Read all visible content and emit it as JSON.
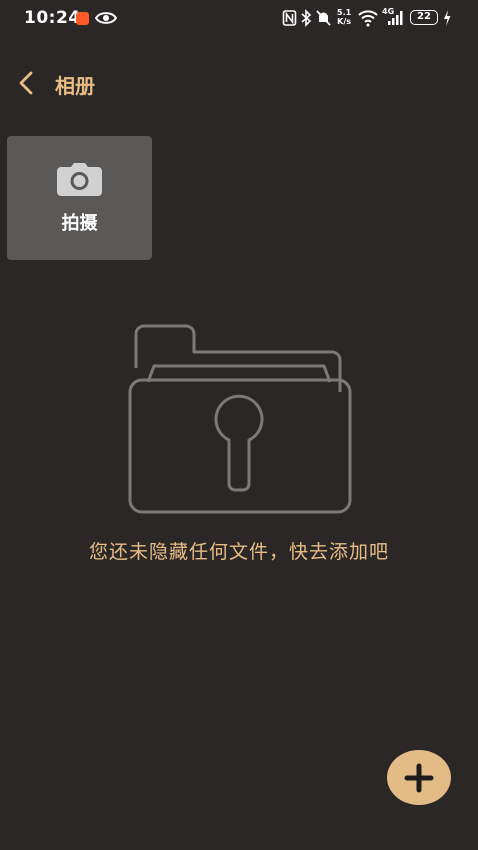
{
  "status_bar": {
    "time": "10:24",
    "network_speed": "5.1",
    "network_unit": "K/s",
    "network_type": "4G",
    "battery": "22"
  },
  "header": {
    "back_icon": "chevron-left-icon",
    "title": "相册"
  },
  "capture_tile": {
    "icon": "camera-icon",
    "label": "拍摄"
  },
  "empty_state": {
    "icon": "locked-folder-icon",
    "message": "您还未隐藏任何文件，快去添加吧"
  },
  "fab": {
    "icon": "plus-icon"
  },
  "colors": {
    "background": "#2b2727",
    "accent": "#e7bd84",
    "tile": "#5b5858",
    "fab": "#e2bb86"
  }
}
